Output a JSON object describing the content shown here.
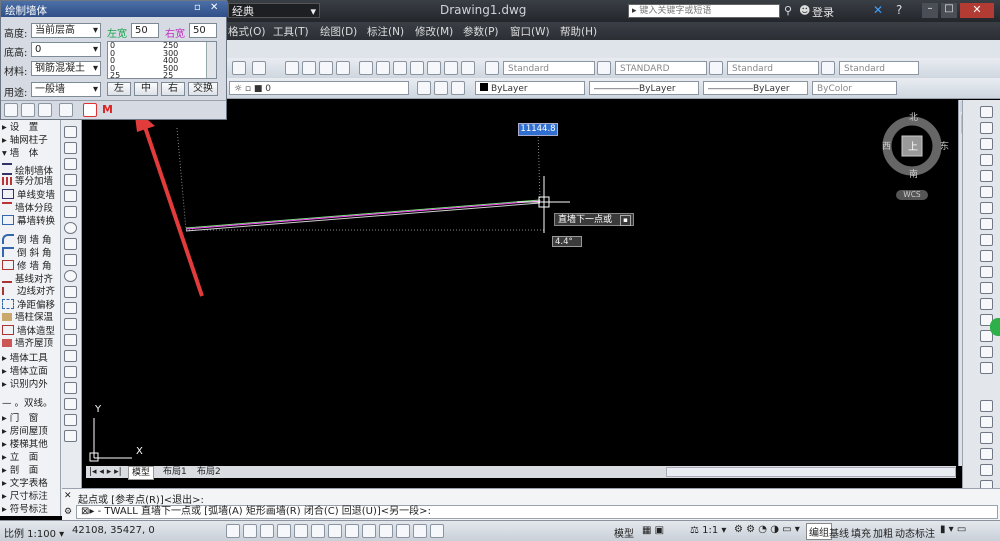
{
  "title_bar": {
    "workspace": "经典",
    "document": "Drawing1.dwg",
    "search_placeholder": "键入关键字或短语",
    "login": "登录"
  },
  "menu": [
    "格式(O)",
    "工具(T)",
    "绘图(D)",
    "标注(N)",
    "修改(M)",
    "参数(P)",
    "窗口(W)",
    "帮助(H)"
  ],
  "styles": {
    "text_style": "Standard",
    "dim_style": "STANDARD",
    "table_style": "Standard",
    "multileader_style": "Standard"
  },
  "properties": {
    "layer": "0",
    "color": "ByLayer",
    "linetype": "ByLayer",
    "lineweight": "ByLayer",
    "plotstyle": "ByColor"
  },
  "wall_panel": {
    "title": "绘制墙体",
    "height_label": "高度:",
    "height_value": "当前层高",
    "left_width_label": "左宽",
    "left_width_value": "50",
    "right_width_label": "右宽",
    "right_width_value": "50",
    "base_label": "底高:",
    "base_value": "0",
    "material_label": "材料:",
    "material_value": "钢筋混凝土",
    "usage_label": "用途:",
    "usage_value": "一般墙",
    "left_list": [
      "0",
      "0",
      "0",
      "0",
      "25"
    ],
    "right_list": [
      "250",
      "300",
      "400",
      "500",
      "25"
    ],
    "btn_left": "左",
    "btn_center": "中",
    "btn_right": "右",
    "btn_swap": "交换",
    "red_m": "M"
  },
  "sidebar": {
    "items": [
      "设　置",
      "轴网柱子",
      "墙　体",
      "绘制墙体",
      "等分加墙",
      "单线变墙",
      "墙体分段",
      "幕墙转换",
      "倒 墙 角",
      "倒 斜 角",
      "修 墙 角",
      "基线对齐",
      "边线对齐",
      "净距偏移",
      "墙柱保温",
      "墙体造型",
      "墙齐屋顶",
      "墙体工具",
      "墙体立面",
      "识别内外",
      "。双线。",
      "门　窗",
      "房间屋顶",
      "楼梯其他",
      "立　面",
      "剖　面",
      "文字表格",
      "尺寸标注",
      "符号标注"
    ]
  },
  "canvas": {
    "dimension_value": "11144.8",
    "tooltip": "直墙下一点或",
    "angle": "4.4°",
    "compass": {
      "north": "北",
      "south": "南",
      "east": "东",
      "west": "西",
      "center": "上",
      "wcs": "WCS"
    },
    "ucs_x": "X",
    "ucs_y": "Y"
  },
  "tabs": [
    "模型",
    "布局1",
    "布局2"
  ],
  "command": {
    "history": "起点或 [参考点(R)]<退出>:",
    "current": "TWALL 直墙下一点或 [弧墙(A) 矩形画墙(R) 闭合(C) 回退(U)]<另一段>:"
  },
  "status": {
    "scale": "比例 1:100",
    "coords": "42108, 35427, 0",
    "model": "模型",
    "annotation_scale": "1:1",
    "edit": "编组",
    "baseline": "基线",
    "fill": "填充",
    "bold": "加粗",
    "dynamic": "动态标注"
  }
}
